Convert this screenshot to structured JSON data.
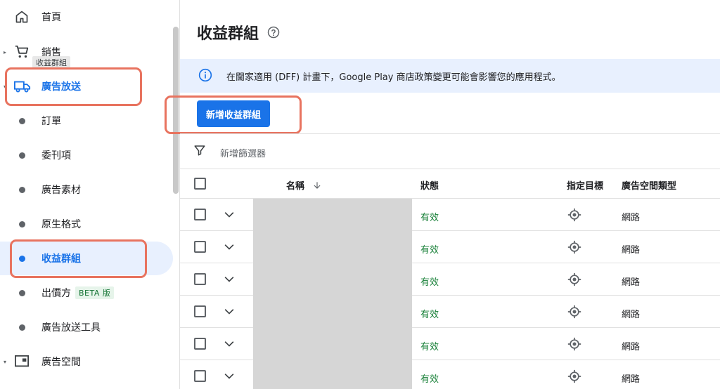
{
  "sidebar": {
    "items": [
      {
        "label": "首頁"
      },
      {
        "label": "銷售"
      },
      {
        "label": "廣告放送"
      },
      {
        "label": "訂單"
      },
      {
        "label": "委刊項"
      },
      {
        "label": "廣告素材"
      },
      {
        "label": "原生格式"
      },
      {
        "label": "收益群組"
      },
      {
        "label": "出價方",
        "badge": "BETA 版"
      },
      {
        "label": "廣告放送工具"
      },
      {
        "label": "廣告空間"
      }
    ],
    "tooltip": "收益群組"
  },
  "main": {
    "title": "收益群組",
    "banner": "在閫家適用 (DFF) 計畫下，Google Play 商店政策變更可能會影響您的應用程式。",
    "add_button": "新增收益群組",
    "filter_placeholder": "新增篩選器",
    "table": {
      "headers": {
        "name": "名稱",
        "status": "狀態",
        "targeting": "指定目標",
        "inventory_type": "廣告空間類型"
      },
      "rows": [
        {
          "status": "有效",
          "inventory_type": "網路"
        },
        {
          "status": "有效",
          "inventory_type": "網路"
        },
        {
          "status": "有效",
          "inventory_type": "網路"
        },
        {
          "status": "有效",
          "inventory_type": "網路"
        },
        {
          "status": "有效",
          "inventory_type": "網路"
        },
        {
          "status": "有效",
          "inventory_type": "網路"
        }
      ]
    }
  },
  "colors": {
    "accent": "#1a73e8",
    "status_active": "#188038",
    "highlight": "#e8735f",
    "banner_bg": "#e8f0fe"
  },
  "icons": {
    "home": "home-icon",
    "sales": "cart-icon",
    "delivery": "truck-icon",
    "inventory": "display-icon",
    "help": "help-icon",
    "info": "info-icon",
    "filter": "filter-icon",
    "sort": "arrow-down-icon",
    "expand": "chevron-down-icon",
    "targeting": "target-icon"
  }
}
